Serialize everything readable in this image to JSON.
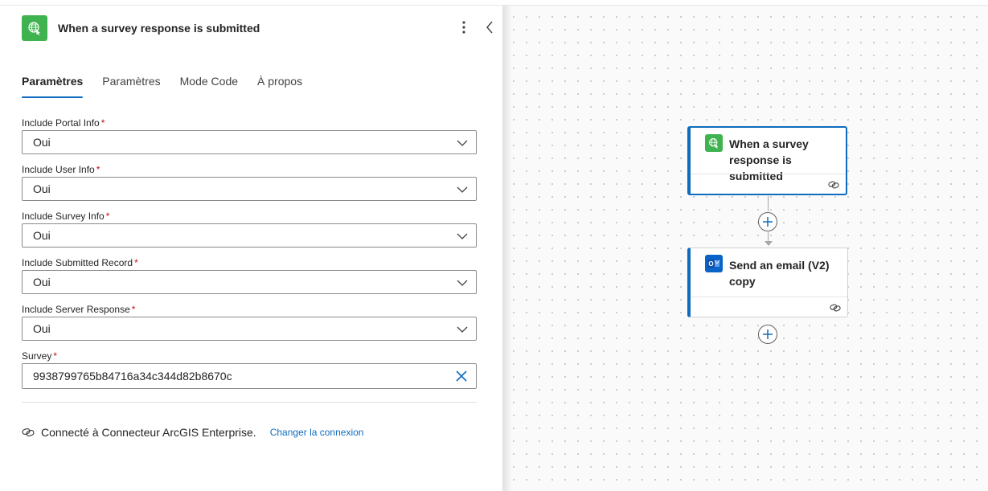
{
  "panel": {
    "title": "When a survey response is submitted",
    "tabs": [
      {
        "label": "Paramètres",
        "active": true
      },
      {
        "label": "Paramètres",
        "active": false
      },
      {
        "label": "Mode Code",
        "active": false
      },
      {
        "label": "À propos",
        "active": false
      }
    ],
    "fields": [
      {
        "label": "Include Portal Info",
        "required": "*",
        "value": "Oui"
      },
      {
        "label": "Include User Info",
        "required": "*",
        "value": "Oui"
      },
      {
        "label": "Include Survey Info",
        "required": "*",
        "value": "Oui"
      },
      {
        "label": "Include Submitted Record",
        "required": "*",
        "value": "Oui"
      },
      {
        "label": "Include Server Response",
        "required": "*",
        "value": "Oui"
      }
    ],
    "survey": {
      "label": "Survey",
      "required": "*",
      "value": "9938799765b84716a34c344d82b8670c"
    },
    "connection": {
      "text": "Connecté à Connecteur ArcGIS Enterprise.",
      "change_label": "Changer la connexion"
    }
  },
  "canvas": {
    "trigger_card": {
      "title": "When a survey response is submitted"
    },
    "action_card": {
      "title": "Send an email (V2) copy"
    }
  },
  "colors": {
    "accent": "#0f6cbd",
    "trigger_icon_bg": "#3fb34f",
    "outlook_icon_bg": "#0a64c8",
    "required": "#c50f1f"
  },
  "icons": {
    "trigger": "survey-globe-icon",
    "action": "outlook-icon",
    "more": "more-vertical-icon",
    "collapse": "chevron-left-icon",
    "dropdown": "chevron-down-icon",
    "clear": "close-icon",
    "connection": "link-icon",
    "add": "plus-icon"
  }
}
